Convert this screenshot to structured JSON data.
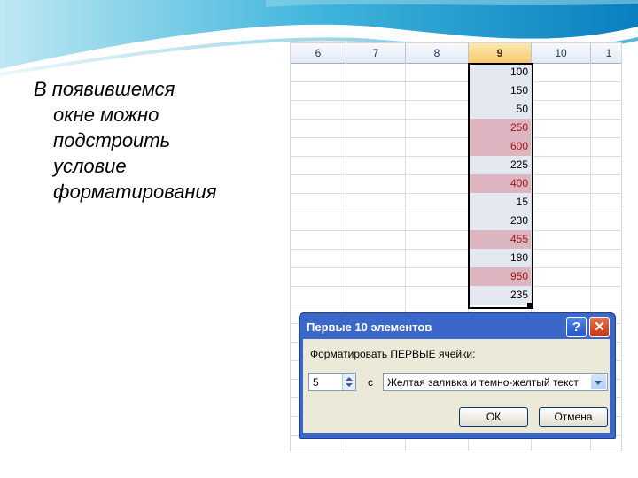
{
  "caption": {
    "line1": "В появившемся",
    "line2": "окне можно",
    "line3": "подстроить",
    "line4": "условие",
    "line5": "форматирования"
  },
  "spreadsheet": {
    "columns": [
      "6",
      "7",
      "8",
      "9",
      "10",
      "1"
    ],
    "selected_column": "9",
    "values": [
      "100",
      "150",
      "50",
      "250",
      "600",
      "225",
      "400",
      "15",
      "230",
      "455",
      "180",
      "950",
      "235"
    ],
    "highlighted": [
      false,
      false,
      false,
      true,
      true,
      false,
      true,
      false,
      false,
      true,
      false,
      true,
      false
    ]
  },
  "dialog": {
    "title": "Первые 10 элементов",
    "help_label": "?",
    "close_label": "✕",
    "format_label": "Форматировать ПЕРВЫЕ ячейки:",
    "count_value": "5",
    "with_label": "с",
    "format_option": "Желтая заливка и темно-желтый текст",
    "ok_label": "ОК",
    "cancel_label": "Отмена"
  },
  "colors": {
    "highlight_fill": "#dcb5c1",
    "highlight_text": "#a31515",
    "dialog_title_bar": "#3a67c8"
  }
}
